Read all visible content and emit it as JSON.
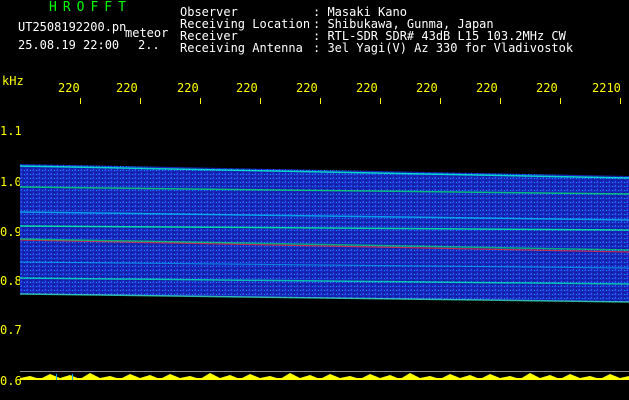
{
  "header": {
    "brand": "HROFFT",
    "filename": "UT2508192200.pn",
    "filename_tag": "meteor",
    "datetime": "25.08.19 22:00",
    "datetime_extra": "2.."
  },
  "info": [
    {
      "label": "Observer",
      "value": ": Masaki Kano"
    },
    {
      "label": "Receiving Location",
      "value": ": Shibukawa, Gunma, Japan"
    },
    {
      "label": "Receiver",
      "value": ": RTL-SDR SDR# 43dB L15 103.2MHz CW"
    },
    {
      "label": "Receiving Antenna",
      "value": ": 3el Yagi(V) Az 330 for Vladivostok"
    }
  ],
  "axis": {
    "unit": "kHz",
    "y_ticks": [
      "1.1",
      "1.0",
      "0.9",
      "0.8",
      "0.7",
      "0.6"
    ],
    "x_ticks": [
      "220",
      "220",
      "220",
      "220",
      "220",
      "220",
      "220",
      "220",
      "220",
      "2210"
    ]
  },
  "colors": {
    "background": "#000000",
    "label_white": "#ffffff",
    "tick_yellow": "#ffff00",
    "brand_green": "#00ff00",
    "spectrum_blue": "#1a2bd0"
  }
}
